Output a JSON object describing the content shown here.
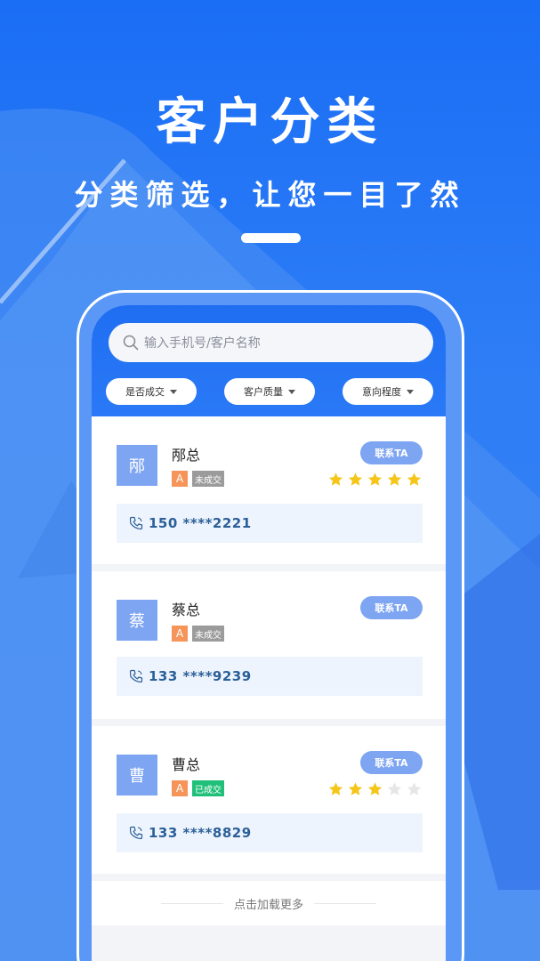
{
  "hero": {
    "title": "客户分类",
    "subtitle": "分类筛选，让您一目了然"
  },
  "search": {
    "placeholder": "输入手机号/客户名称",
    "icon": "search-icon"
  },
  "filters": [
    {
      "label": "是否成交"
    },
    {
      "label": "客户质量"
    },
    {
      "label": "意向程度"
    }
  ],
  "customers": [
    {
      "avatar": "邴",
      "name": "邴总",
      "grade": "A",
      "status": "未成交",
      "status_type": "pending",
      "contact_label": "联系TA",
      "rating": 5,
      "phone": "150 ****2221"
    },
    {
      "avatar": "蔡",
      "name": "蔡总",
      "grade": "A",
      "status": "未成交",
      "status_type": "pending",
      "contact_label": "联系TA",
      "rating": 0,
      "phone": "133 ****9239"
    },
    {
      "avatar": "曹",
      "name": "曹总",
      "grade": "A",
      "status": "已成交",
      "status_type": "done",
      "contact_label": "联系TA",
      "rating": 3,
      "phone": "133 ****8829"
    }
  ],
  "load_more": "点击加载更多",
  "colors": {
    "primary": "#1f6ef2",
    "avatar": "#7ea5f2",
    "grade": "#f5955a",
    "pending": "#9b9b9b",
    "done": "#21c07a",
    "star": "#f5c518",
    "star_empty": "#e6e6e6"
  }
}
